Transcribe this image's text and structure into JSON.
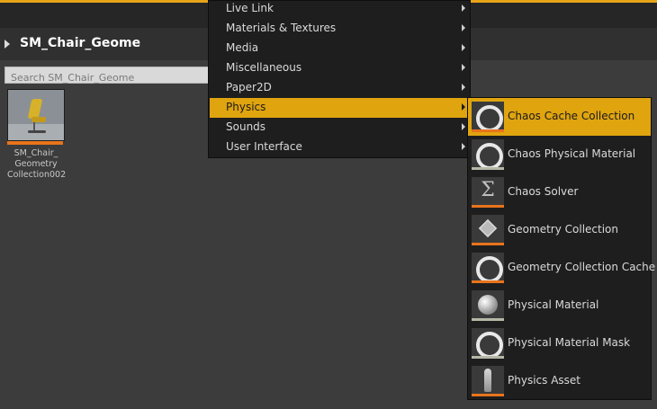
{
  "header": {
    "title": "SM_Chair_Geome"
  },
  "search": {
    "placeholder": "Search SM_Chair_Geome"
  },
  "asset": {
    "label_lines": [
      "SM_Chair_",
      "Geometry",
      "Collection002"
    ]
  },
  "menu": {
    "items": [
      {
        "label": "Live Link"
      },
      {
        "label": "Materials & Textures"
      },
      {
        "label": "Media"
      },
      {
        "label": "Miscellaneous"
      },
      {
        "label": "Paper2D"
      },
      {
        "label": "Physics"
      },
      {
        "label": "Sounds"
      },
      {
        "label": "User Interface"
      }
    ],
    "active_index": 5
  },
  "submenu": {
    "items": [
      {
        "label": "Chaos Cache Collection",
        "icon": "ring-icon",
        "strip_color": "#e8741c"
      },
      {
        "label": "Chaos Physical Material",
        "icon": "ring-icon",
        "strip_color": "#b7b7a8"
      },
      {
        "label": "Chaos Solver",
        "icon": "sigma-icon",
        "strip_color": "#e8741c"
      },
      {
        "label": "Geometry Collection",
        "icon": "cube-stack-icon",
        "strip_color": "#e8741c"
      },
      {
        "label": "Geometry Collection Cache",
        "icon": "ring-icon",
        "strip_color": "#e8741c"
      },
      {
        "label": "Physical Material",
        "icon": "sphere-icon",
        "strip_color": "#b7b7a8"
      },
      {
        "label": "Physical Material Mask",
        "icon": "ring-icon",
        "strip_color": "#b7b7a8"
      },
      {
        "label": "Physics Asset",
        "icon": "figure-icon",
        "strip_color": "#e8741c"
      }
    ],
    "active_index": 0
  },
  "colors": {
    "accent": "#e0a40f",
    "menu_bg": "#1e1e1e",
    "panel_bg": "#3c3c3c",
    "asset_stripe": "#e8741c"
  }
}
